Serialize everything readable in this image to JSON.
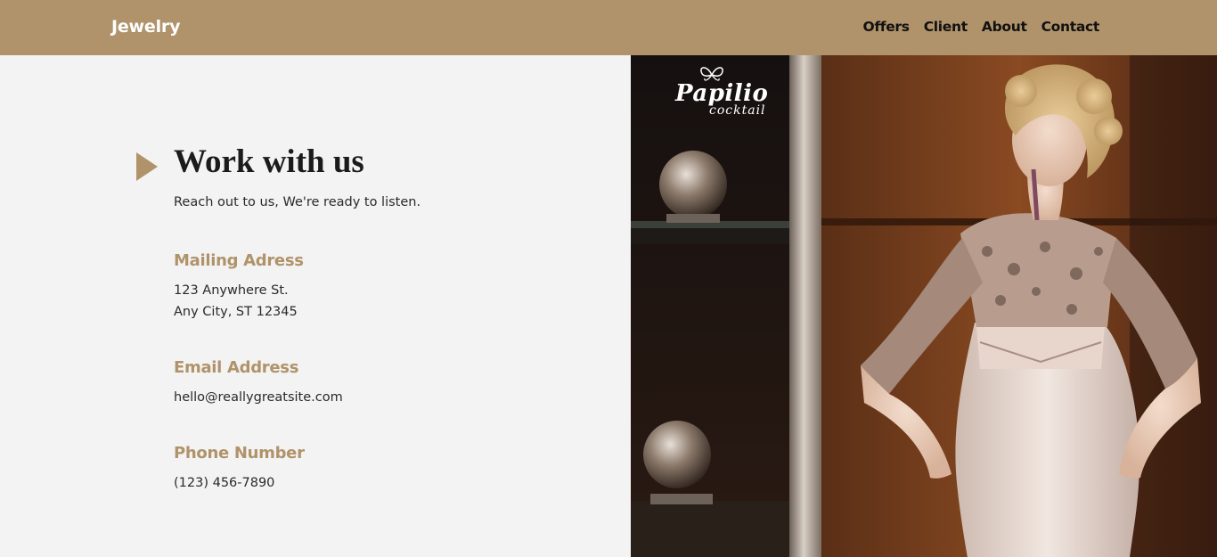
{
  "nav": {
    "brand": "Jewelry",
    "links": [
      "Offers",
      "Client",
      "About",
      "Contact"
    ]
  },
  "main": {
    "title": "Work with us",
    "subtitle": "Reach out to us, We're ready to listen.",
    "sections": [
      {
        "heading": "Mailing Adress",
        "lines": [
          "123 Anywhere St.",
          "Any City, ST 12345"
        ]
      },
      {
        "heading": "Email Address",
        "lines": [
          "hello@reallygreatsite.com"
        ]
      },
      {
        "heading": "Phone Number",
        "lines": [
          "(123) 456-7890"
        ]
      }
    ]
  },
  "hero": {
    "logo_word": "Papilio",
    "logo_sub": "cocktail"
  },
  "colors": {
    "accent": "#b0936a",
    "background": "#f3f3f3",
    "text": "#1b1b1b"
  },
  "icons": {
    "section_marker": "play-triangle-icon",
    "logo_mark": "butterfly-icon"
  }
}
